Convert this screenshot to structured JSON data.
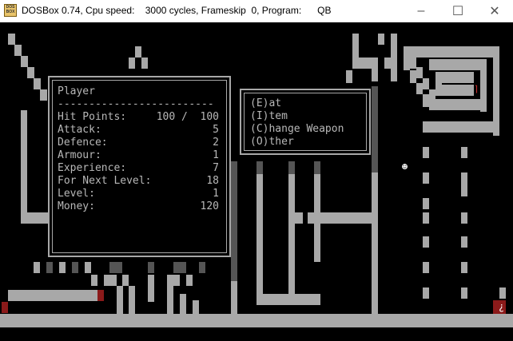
{
  "window": {
    "app_icon_text": "DOS BOX",
    "title": "DOSBox 0.74, Cpu speed:    3000 cycles, Frameskip  0, Program:      QB",
    "minimize_glyph": "–",
    "maximize_glyph": "☐",
    "close_glyph": "✕"
  },
  "player_panel": {
    "title": "Player",
    "divider": "-------------------------",
    "stats": [
      {
        "label": "Hit Points:",
        "value": "100 /  100"
      },
      {
        "label": "Attack:",
        "value": "5"
      },
      {
        "label": "Defence:",
        "value": "2"
      },
      {
        "label": "Armour:",
        "value": "1"
      },
      {
        "label": "Experience:",
        "value": "7"
      },
      {
        "label": "For Next Level:",
        "value": "18"
      },
      {
        "label": "Level:",
        "value": "1"
      },
      {
        "label": "Money:",
        "value": "120"
      }
    ]
  },
  "action_menu": {
    "items": [
      {
        "label": "(E)at"
      },
      {
        "label": "(I)tem"
      },
      {
        "label": "(C)hange Weapon"
      },
      {
        "label": "(O)ther"
      }
    ]
  },
  "map": {
    "player_glyph": "☻",
    "exit_glyph": "¿",
    "marker_glyph": "⌉"
  },
  "colors": {
    "wall": "#a8a8a8",
    "dark_wall": "#555555",
    "red_tile": "#8b1a1a",
    "text": "#b8b8b8",
    "background": "#000000"
  }
}
